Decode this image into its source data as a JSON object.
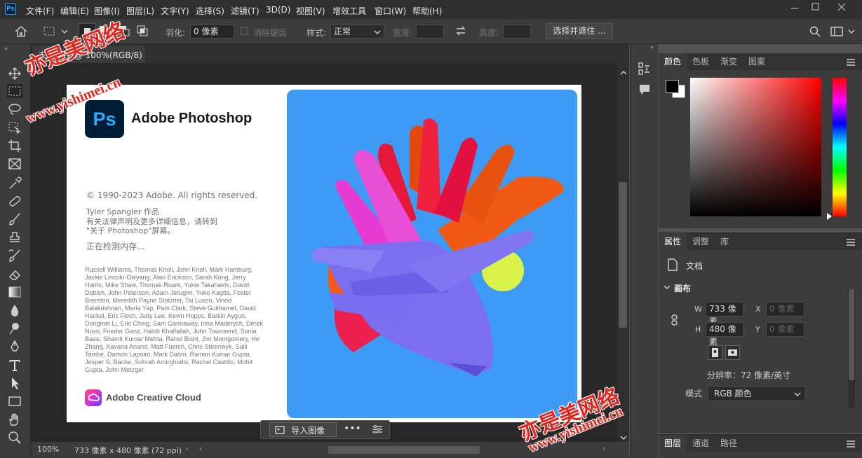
{
  "app": {
    "logo": "Ps"
  },
  "menu": [
    "文件(F)",
    "编辑(E)",
    "图像(I)",
    "图层(L)",
    "文字(Y)",
    "选择(S)",
    "滤镜(T)",
    "3D(D)",
    "视图(V)",
    "增效工具",
    "窗口(W)",
    "帮助(H)"
  ],
  "options": {
    "feather_label": "羽化:",
    "feather_value": "0 像素",
    "antialias_label": "消除锯齿",
    "style_label": "样式:",
    "style_value": "正常",
    "width_label": "宽度:",
    "height_label": "高度:",
    "select_mask_button": "选择并遮住 ..."
  },
  "document": {
    "tab_title": "未标题-1 @ 100%(RGB/8)"
  },
  "splash": {
    "logo": "Ps",
    "product_name": "Adobe Photoshop",
    "copyright": "© 1990-2023 Adobe. All rights reserved.",
    "artwork_credit": "Tyler Spangler 作品",
    "legal_line1": "有关法律声明及更多详细信息，请转到",
    "legal_line2": "\"关于 Photoshop\"屏幕。",
    "status": "正在检测内存...",
    "credits": "Russell Williams, Thomas Knoll, John Knoll, Mark Hamburg, Jackie Lincoln-Owyang, Alan Erickson, Sarah Kong, Jerry Harris, Mike Shaw, Thomas Ruark, Yukie Takahashi, David Dobish, John Peterson, Adam Jerugim, Yuko Kagita, Foster Brereton, Meredith Payne Stotzner, Tai Luxon, Vinod Balakrishnan, Maria Yap, Pam Clark, Steve Guilhamet, David Hackel, Eric Floch, Judy Lee, Kevin Hopps, Barkin Aygun, Dongmei Li, Eric Ching, Sam Gannaway, Irina Maderych, Derek Novo, Frieder Ganz, Habib Khalfallah, John Townsend, Sonia Baee, Shamit Kumar Mehta, Rahul Bisht, Jim Montgomery, He Zhang, Kavana Anand, Matt Fuerch, Chris Steenwyk, Salil Tambe, Damon Lapoint, Mark Dahm, Raman Kumar Gupta, Jesper S. Bache, Sohrab Amirghodsi, Rachel Castillo, Mohit Gupta, John Metzger",
    "cc_label": "Adobe Creative Cloud"
  },
  "context_bar": {
    "import_label": "导入图像"
  },
  "status": {
    "zoom": "100%",
    "doc_info": "733 像素 x 480 像素 (72 ppi)"
  },
  "color_panel": {
    "tabs": [
      "颜色",
      "色板",
      "渐变",
      "图案"
    ]
  },
  "properties": {
    "tabs": [
      "属性",
      "调整",
      "库"
    ],
    "doc_label": "文档",
    "section": "画布",
    "w_label": "W",
    "w_value": "733 像素",
    "h_label": "H",
    "h_value": "480 像素",
    "x_label": "X",
    "x_placeholder": "0 像素",
    "y_label": "Y",
    "y_placeholder": "0 像素",
    "resolution": "分辨率：72 像素/英寸",
    "mode_label": "模式",
    "mode_value": "RGB 颜色"
  },
  "layers_panel": {
    "tabs": [
      "图层",
      "通道",
      "路径"
    ]
  },
  "watermark": {
    "title": "亦是美网络",
    "url": "www.yishimei.cn"
  },
  "colors": {
    "ps_blue": "#31a8ff",
    "ps_dark": "#001e36",
    "splash_bg": "#3d9bf6"
  }
}
